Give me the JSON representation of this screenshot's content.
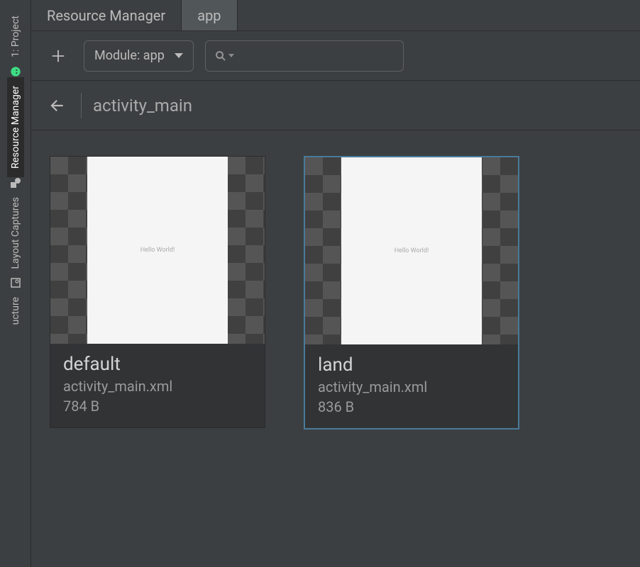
{
  "rail": {
    "tabs": [
      {
        "label": "1: Project"
      },
      {
        "label": "Resource Manager"
      },
      {
        "label": "Layout Captures"
      },
      {
        "label": "ucture"
      }
    ]
  },
  "tabs": {
    "main": "Resource Manager",
    "secondary": "app"
  },
  "toolbar": {
    "module_label": "Module: app",
    "search_placeholder": ""
  },
  "breadcrumb": {
    "current": "activity_main"
  },
  "preview_text": "Hello World!",
  "resources": [
    {
      "qualifier": "default",
      "filename": "activity_main.xml",
      "size": "784 B",
      "selected": false
    },
    {
      "qualifier": "land",
      "filename": "activity_main.xml",
      "size": "836 B",
      "selected": true
    }
  ]
}
